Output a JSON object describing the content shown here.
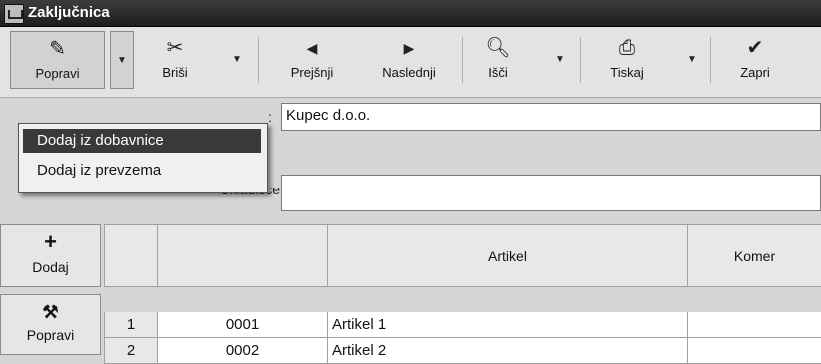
{
  "window": {
    "title": "Zaključnica"
  },
  "toolbar": {
    "edit_label": "Popravi",
    "delete_label": "Briši",
    "previous_label": "Prejšnji",
    "next_label": "Naslednji",
    "search_label": "Išči",
    "print_label": "Tiskaj",
    "close_label": "Zapri"
  },
  "dropdown_menu": {
    "items": [
      {
        "label": "Dodaj iz dobavnice",
        "selected": true
      },
      {
        "label": "Dodaj iz prevzema",
        "selected": false
      }
    ]
  },
  "form": {
    "customer_value": "Kupec d.o.o.",
    "warehouse_label": "Skladišče",
    "warehouse_value": ""
  },
  "grid": {
    "add_button_label": "Dodaj",
    "edit_button_label": "Popravi",
    "columns": [
      "",
      "",
      "Artikel",
      "Komer"
    ],
    "rows": [
      {
        "num": "1",
        "code": "0001",
        "article": "Artikel 1",
        "comment": ""
      },
      {
        "num": "2",
        "code": "0002",
        "article": "Artikel 2",
        "comment": ""
      }
    ]
  }
}
